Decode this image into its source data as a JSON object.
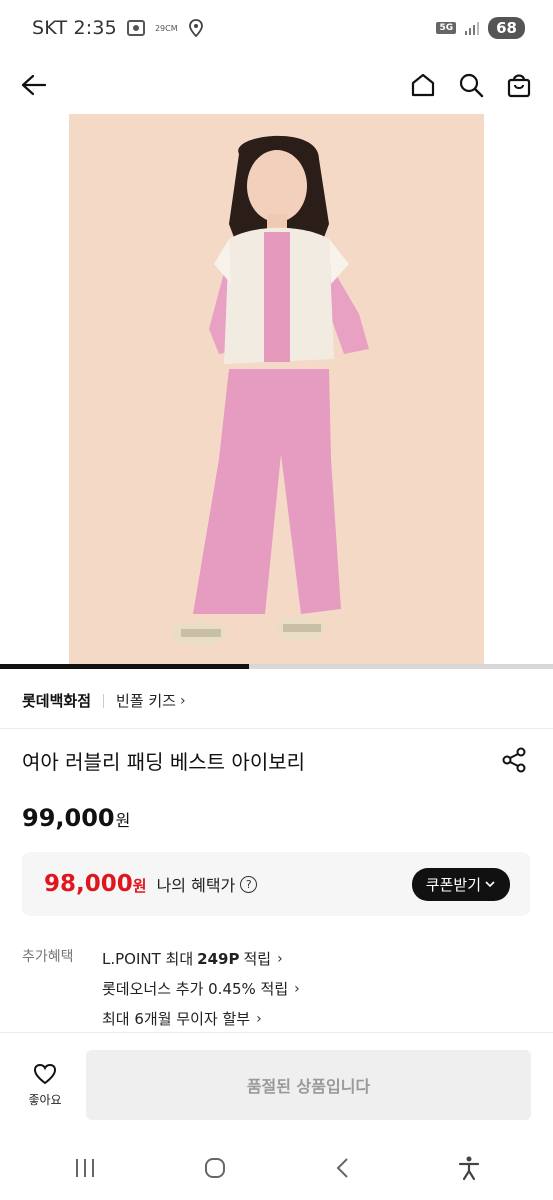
{
  "status_bar": {
    "carrier_time": "SKT 2:35",
    "weather_text": "29CM",
    "network": "5G",
    "battery": "68"
  },
  "app_bar": {
    "back_icon": "arrow-left-icon",
    "home_icon": "home-icon",
    "search_icon": "search-icon",
    "cart_icon": "shopping-bag-icon"
  },
  "hero": {
    "background_color": "#f3d9c6",
    "carousel_progress_fraction": 0.45
  },
  "seller": {
    "store": "롯데백화점",
    "brand": "빈폴 키즈",
    "chevron": "›"
  },
  "product": {
    "title": "여아 러블리 패딩 베스트 아이보리",
    "price_value": "99,000",
    "price_unit": "원"
  },
  "benefit": {
    "price_value": "98,000",
    "price_unit": "원",
    "label": "나의 혜택가",
    "help": "?",
    "coupon_button": "쿠폰받기",
    "accent_color": "#e0161e"
  },
  "extra_benefits": {
    "label": "추가혜택",
    "items": [
      {
        "prefix": "L.POINT 최대",
        "highlight": "249P",
        "suffix": "적립"
      },
      {
        "prefix": "롯데오너스 추가 0.45% 적립",
        "highlight": "",
        "suffix": ""
      },
      {
        "prefix": "최대 6개월 무이자 할부",
        "highlight": "",
        "suffix": ""
      }
    ],
    "chevron": "›"
  },
  "bottom_bar": {
    "like_label": "좋아요",
    "soldout_label": "품절된 상품입니다"
  }
}
